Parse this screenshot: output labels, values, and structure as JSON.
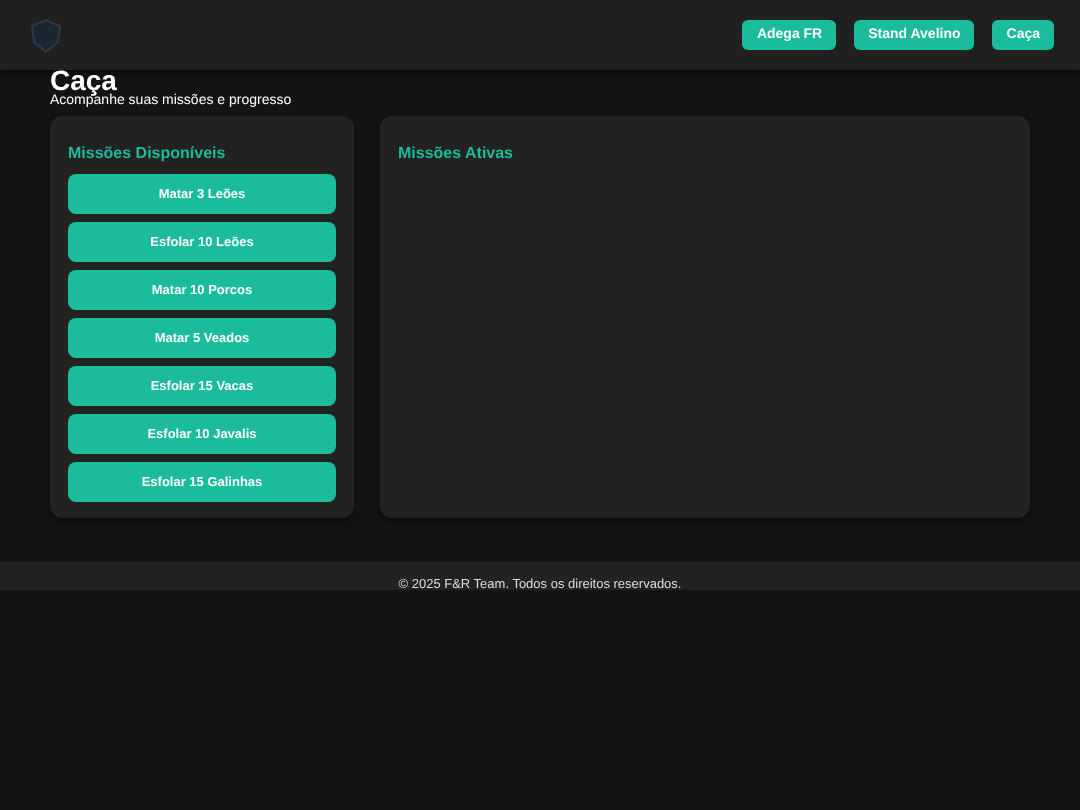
{
  "nav": [
    "Adega FR",
    "Stand Avelino",
    "Caça"
  ],
  "page": {
    "title": "Caça",
    "subtitle": "Acompanhe suas missões e progresso"
  },
  "available": {
    "title": "Missões Disponíveis",
    "missions": [
      "Matar 3 Leões",
      "Esfolar 10 Leões",
      "Matar 10 Porcos",
      "Matar 5 Veados",
      "Esfolar 15 Vacas",
      "Esfolar 10 Javalis",
      "Esfolar 15 Galinhas"
    ]
  },
  "active": {
    "title": "Missões Ativas"
  },
  "footer": "© 2025 F&R Team. Todos os direitos reservados."
}
